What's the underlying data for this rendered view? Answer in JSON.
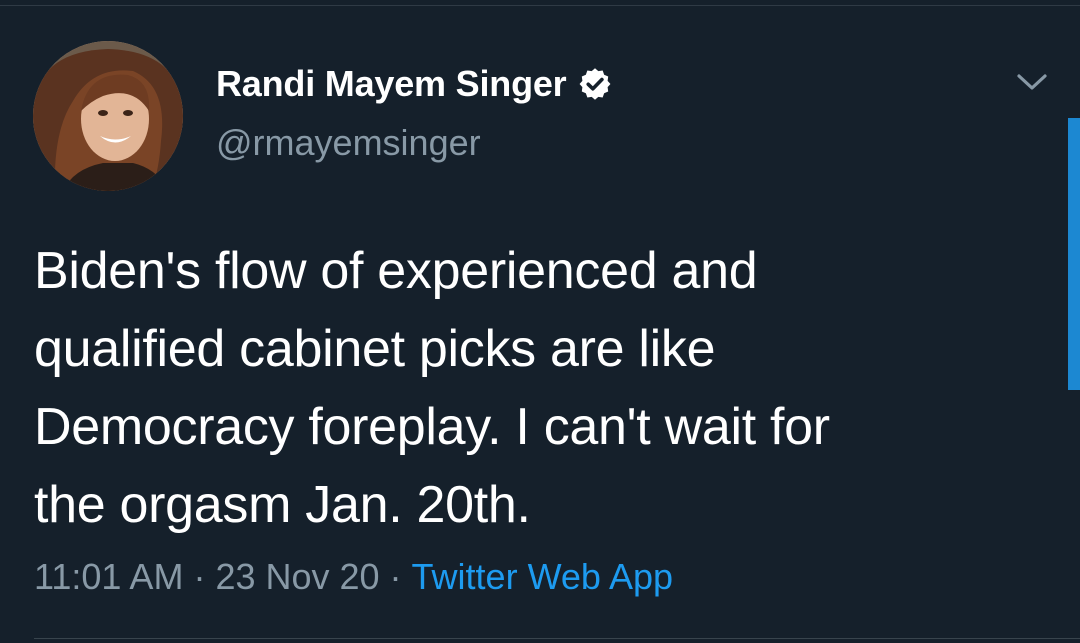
{
  "tweet": {
    "author": {
      "display_name": "Randi Mayem Singer",
      "handle": "@rmayemsinger",
      "verified": true
    },
    "text": "Biden's flow of experienced and\nqualified cabinet picks are like\nDemocracy foreplay. I can't wait for\nthe orgasm Jan. 20th.",
    "time": "11:01 AM",
    "date": "23 Nov 20",
    "separator": "·",
    "source": "Twitter Web App"
  },
  "colors": {
    "background": "#15202b",
    "primary_text": "#ffffff",
    "secondary_text": "#8899a6",
    "accent": "#1d9bf0"
  },
  "icons": {
    "verified": "verified-badge-icon",
    "menu": "chevron-down-icon"
  }
}
